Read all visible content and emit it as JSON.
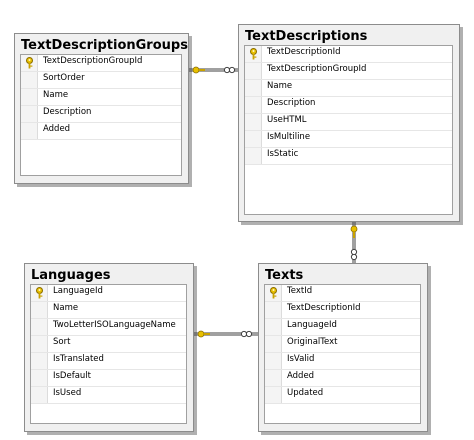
{
  "colors": {
    "key_gold": "#e8c000",
    "border": "#8c8c8c",
    "line": "#404040"
  },
  "tables": {
    "text_description_groups": {
      "title": "TextDescriptionGroups",
      "columns": [
        "TextDescriptionGroupId",
        "SortOrder",
        "Name",
        "Description",
        "Added"
      ]
    },
    "text_descriptions": {
      "title": "TextDescriptions",
      "columns": [
        "TextDescriptionId",
        "TextDescriptionGroupId",
        "Name",
        "Description",
        "UseHTML",
        "IsMultiline",
        "IsStatic"
      ]
    },
    "languages": {
      "title": "Languages",
      "columns": [
        "LanguageId",
        "Name",
        "TwoLetterISOLanguageName",
        "Sort",
        "IsTranslated",
        "IsDefault",
        "IsUsed"
      ]
    },
    "texts": {
      "title": "Texts",
      "columns": [
        "TextId",
        "TextDescriptionId",
        "LanguageId",
        "OriginalText",
        "IsValid",
        "Added",
        "Updated"
      ]
    }
  }
}
